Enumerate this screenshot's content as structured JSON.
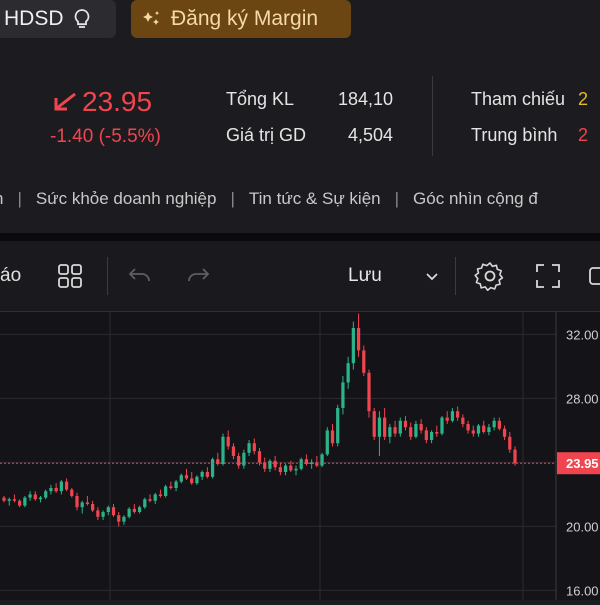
{
  "header": {
    "hdsd_label": "HDSD",
    "margin_label": "Đăng ký Margin"
  },
  "quote": {
    "price": "23.95",
    "change": "-1.40 (-5.5%)",
    "stats": [
      {
        "label": "Tổng KL",
        "value": "184,10"
      },
      {
        "label": "Giá trị GD",
        "value": "4,504"
      }
    ],
    "ref": [
      {
        "label": "Tham chiếu",
        "value": "2"
      },
      {
        "label": "Trung bình",
        "value": "2"
      }
    ],
    "colors": {
      "down": "#f0454e",
      "up": "#2bb48a",
      "ref": "#e8b923"
    }
  },
  "nav": {
    "items": [
      "n",
      "Sức khỏe doanh nghiệp",
      "Tin tức & Sự kiện",
      "Góc nhìn cộng đ"
    ]
  },
  "toolbar": {
    "left_text": "áo",
    "save_label": "Lưu",
    "icons": [
      "grid-icon",
      "undo-icon",
      "redo-icon",
      "chevron-down-icon",
      "gear-icon",
      "fullscreen-icon",
      "camera-icon"
    ]
  },
  "chart_data": {
    "type": "candlestick",
    "y_ticks": [
      "32.00",
      "28.00",
      "24.00",
      "20.00",
      "16.00"
    ],
    "y_tick_values": [
      32,
      28,
      24,
      20,
      16
    ],
    "ylim": [
      15.4,
      33.4
    ],
    "current_price_label": "23.95",
    "current_price": 23.95,
    "candles": [
      [
        21.8,
        21.9,
        21.5,
        21.6
      ],
      [
        21.6,
        21.8,
        21.3,
        21.7
      ],
      [
        21.7,
        22.0,
        21.5,
        21.6
      ],
      [
        21.6,
        21.7,
        21.2,
        21.3
      ],
      [
        21.3,
        21.9,
        21.2,
        21.8
      ],
      [
        21.8,
        22.2,
        21.6,
        22.0
      ],
      [
        22.0,
        22.2,
        21.6,
        21.7
      ],
      [
        21.7,
        21.9,
        21.5,
        21.8
      ],
      [
        21.8,
        22.3,
        21.7,
        22.2
      ],
      [
        22.2,
        22.6,
        22.0,
        22.4
      ],
      [
        22.4,
        22.7,
        22.1,
        22.2
      ],
      [
        22.2,
        22.9,
        22.0,
        22.8
      ],
      [
        22.8,
        23.0,
        22.2,
        22.3
      ],
      [
        22.3,
        22.4,
        21.8,
        21.9
      ],
      [
        21.9,
        22.1,
        21.0,
        21.2
      ],
      [
        21.2,
        21.6,
        20.8,
        21.5
      ],
      [
        21.5,
        21.9,
        21.3,
        21.4
      ],
      [
        21.4,
        21.6,
        20.9,
        21.0
      ],
      [
        21.0,
        21.2,
        20.4,
        20.6
      ],
      [
        20.6,
        21.0,
        20.4,
        20.9
      ],
      [
        20.9,
        21.3,
        20.7,
        21.2
      ],
      [
        21.2,
        21.4,
        20.6,
        20.7
      ],
      [
        20.7,
        20.9,
        20.0,
        20.3
      ],
      [
        20.3,
        20.7,
        20.1,
        20.6
      ],
      [
        20.6,
        21.2,
        20.5,
        21.1
      ],
      [
        21.1,
        21.4,
        20.8,
        20.9
      ],
      [
        20.9,
        21.3,
        20.8,
        21.2
      ],
      [
        21.2,
        21.8,
        21.1,
        21.7
      ],
      [
        21.7,
        22.0,
        21.5,
        21.6
      ],
      [
        21.6,
        22.1,
        21.4,
        22.0
      ],
      [
        22.0,
        22.3,
        21.8,
        21.9
      ],
      [
        21.9,
        22.6,
        21.8,
        22.5
      ],
      [
        22.5,
        22.8,
        22.3,
        22.4
      ],
      [
        22.4,
        22.9,
        22.2,
        22.8
      ],
      [
        22.8,
        23.3,
        22.7,
        23.2
      ],
      [
        23.2,
        23.6,
        22.9,
        23.0
      ],
      [
        23.0,
        23.4,
        22.6,
        22.7
      ],
      [
        22.7,
        23.2,
        22.6,
        23.1
      ],
      [
        23.1,
        23.5,
        22.9,
        23.4
      ],
      [
        23.4,
        23.7,
        23.0,
        23.1
      ],
      [
        23.1,
        24.3,
        23.0,
        24.2
      ],
      [
        24.2,
        24.6,
        23.8,
        23.9
      ],
      [
        23.9,
        25.8,
        23.8,
        25.6
      ],
      [
        25.6,
        26.0,
        24.8,
        25.0
      ],
      [
        25.0,
        25.2,
        24.2,
        24.4
      ],
      [
        24.4,
        24.6,
        23.6,
        23.8
      ],
      [
        23.8,
        24.8,
        23.6,
        24.6
      ],
      [
        24.6,
        25.4,
        24.4,
        25.2
      ],
      [
        25.2,
        25.5,
        24.5,
        24.7
      ],
      [
        24.7,
        24.9,
        23.8,
        24.0
      ],
      [
        24.0,
        24.3,
        23.4,
        23.6
      ],
      [
        23.6,
        24.2,
        23.4,
        24.1
      ],
      [
        24.1,
        24.4,
        23.5,
        23.7
      ],
      [
        23.7,
        24.0,
        23.2,
        23.4
      ],
      [
        23.4,
        23.9,
        23.2,
        23.8
      ],
      [
        23.8,
        24.1,
        23.4,
        23.5
      ],
      [
        23.5,
        23.8,
        23.2,
        23.6
      ],
      [
        23.6,
        24.3,
        23.5,
        24.2
      ],
      [
        24.2,
        24.5,
        23.8,
        23.9
      ],
      [
        23.9,
        24.2,
        23.6,
        24.0
      ],
      [
        24.0,
        24.4,
        23.7,
        23.8
      ],
      [
        23.8,
        24.6,
        23.7,
        24.5
      ],
      [
        24.5,
        26.2,
        24.4,
        26.0
      ],
      [
        26.0,
        26.4,
        25.0,
        25.2
      ],
      [
        25.2,
        27.6,
        25.0,
        27.4
      ],
      [
        27.4,
        29.4,
        27.0,
        29.0
      ],
      [
        29.0,
        30.6,
        28.6,
        30.2
      ],
      [
        30.2,
        32.8,
        29.8,
        32.4
      ],
      [
        32.4,
        33.3,
        30.6,
        31.0
      ],
      [
        31.0,
        31.3,
        29.4,
        29.6
      ],
      [
        29.6,
        29.8,
        26.8,
        27.2
      ],
      [
        27.2,
        27.4,
        25.4,
        25.6
      ],
      [
        25.6,
        27.2,
        24.4,
        26.8
      ],
      [
        26.8,
        27.4,
        25.4,
        25.6
      ],
      [
        25.6,
        26.4,
        25.2,
        26.2
      ],
      [
        26.2,
        26.6,
        25.6,
        25.8
      ],
      [
        25.8,
        26.8,
        25.6,
        26.6
      ],
      [
        26.6,
        26.9,
        26.0,
        26.2
      ],
      [
        26.2,
        26.5,
        25.4,
        25.6
      ],
      [
        25.6,
        26.6,
        25.5,
        26.4
      ],
      [
        26.4,
        26.7,
        25.8,
        26.0
      ],
      [
        26.0,
        26.2,
        25.2,
        25.4
      ],
      [
        25.4,
        26.0,
        25.2,
        25.9
      ],
      [
        25.9,
        26.3,
        25.6,
        25.8
      ],
      [
        25.8,
        26.9,
        25.7,
        26.8
      ],
      [
        26.8,
        27.2,
        26.4,
        26.6
      ],
      [
        26.6,
        27.4,
        26.5,
        27.2
      ],
      [
        27.2,
        27.5,
        26.6,
        26.8
      ],
      [
        26.8,
        27.0,
        26.2,
        26.4
      ],
      [
        26.4,
        26.6,
        25.8,
        26.0
      ],
      [
        26.0,
        26.3,
        25.6,
        25.8
      ],
      [
        25.8,
        26.4,
        25.6,
        26.3
      ],
      [
        26.3,
        26.6,
        25.8,
        25.9
      ],
      [
        25.9,
        26.4,
        25.7,
        26.2
      ],
      [
        26.2,
        26.8,
        26.0,
        26.6
      ],
      [
        26.6,
        26.8,
        26.0,
        26.1
      ],
      [
        26.1,
        26.3,
        25.4,
        25.6
      ],
      [
        25.6,
        25.9,
        24.6,
        24.8
      ],
      [
        24.8,
        25.0,
        23.8,
        23.95
      ]
    ]
  }
}
